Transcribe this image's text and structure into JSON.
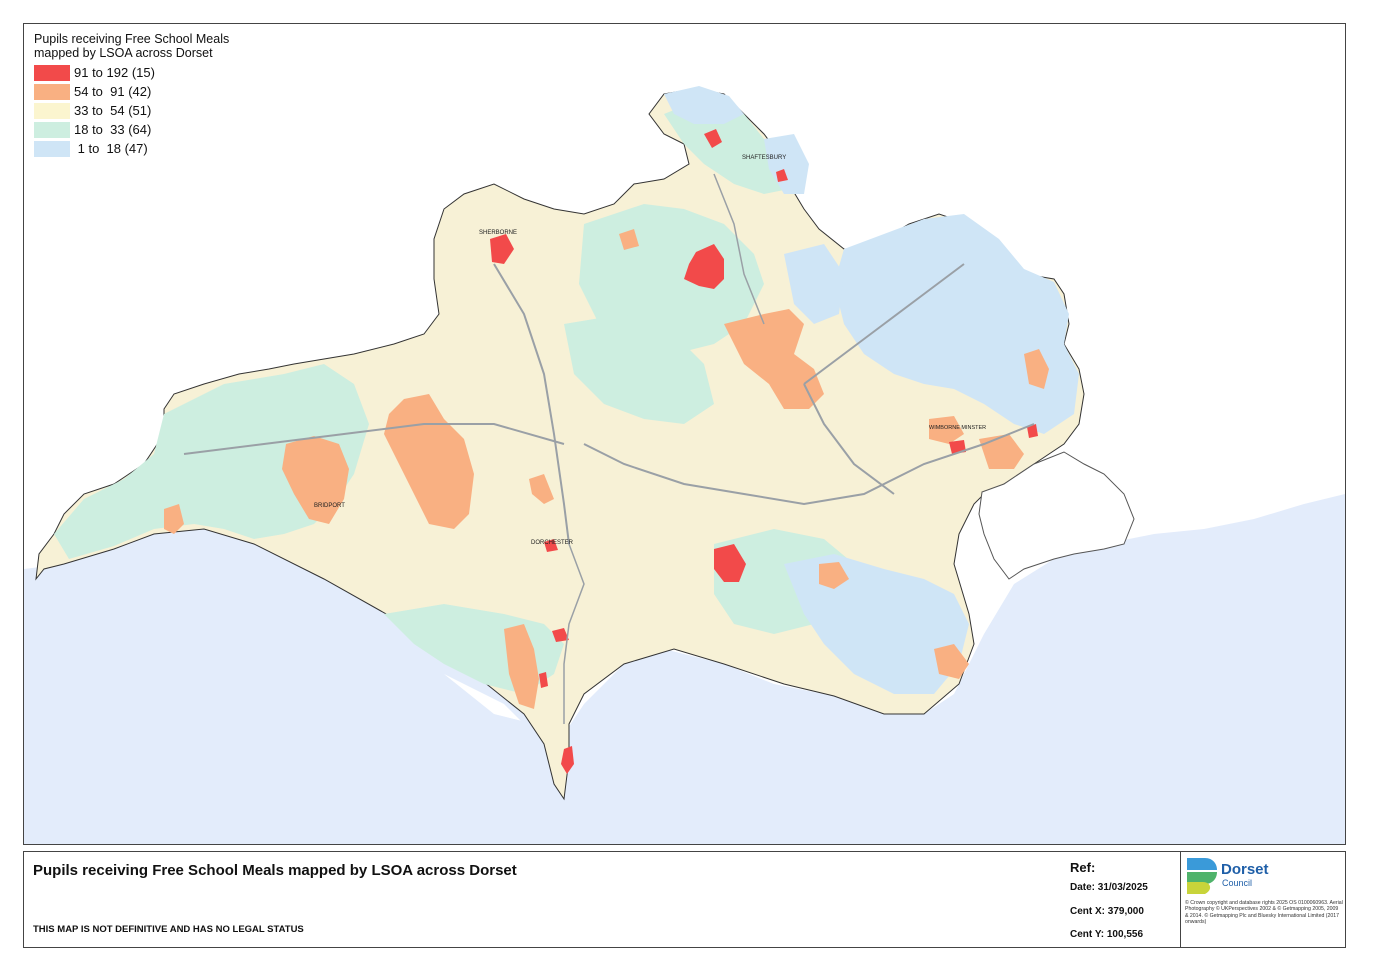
{
  "legend": {
    "title_line1": "Pupils receiving Free School Meals",
    "title_line2": "mapped by LSOA across Dorset",
    "classes": [
      {
        "label": "91 to 192 (15)",
        "color": "#f24a4a"
      },
      {
        "label": "54 to  91 (42)",
        "color": "#f9b082"
      },
      {
        "label": "33 to  54 (51)",
        "color": "#fbf5cf"
      },
      {
        "label": "18 to  33 (64)",
        "color": "#cdeee0"
      },
      {
        "label": " 1 to  18 (47)",
        "color": "#cfe5f6"
      }
    ]
  },
  "map": {
    "sea_color": "#e3ecfb",
    "land_outline_color": "#333333",
    "label_shaftesbury": "SHAFTESBURY",
    "label_bridport": "BRIDPORT",
    "label_dorchester": "DORCHESTER",
    "label_wimborne": "WIMBORNE MINSTER",
    "label_sherborne": "SHERBORNE"
  },
  "footer": {
    "title": "Pupils receiving Free School Meals mapped by LSOA across Dorset",
    "disclaimer": "THIS MAP IS NOT DEFINITIVE AND HAS NO LEGAL STATUS",
    "ref_label": "Ref:",
    "date": "Date: 31/03/2025",
    "cent_x": "Cent X: 379,000",
    "cent_y": "Cent Y: 100,556",
    "brand_name": "Dorset",
    "brand_sub": "Council",
    "copyright": "© Crown copyright and database rights 2025 OS 0100060963. Aerial Photography © UKPerspectives 2002 & © Getmapping 2005, 2009 & 2014. © Getmapping Plc and Bluesky International Limited (2017 onwards)"
  }
}
